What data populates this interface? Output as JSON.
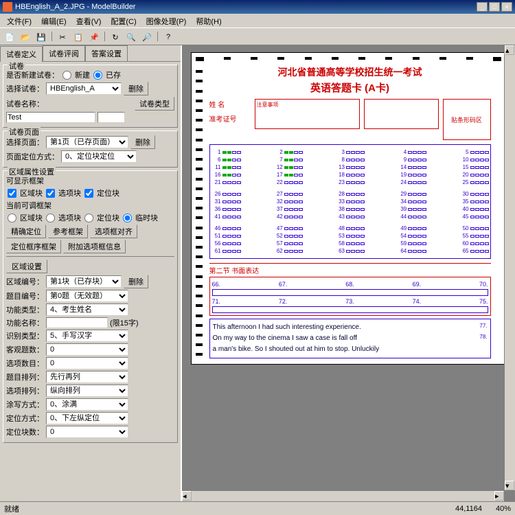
{
  "window": {
    "title": "HBEnglish_A_2.JPG - ModelBuilder"
  },
  "menu": [
    "文件(F)",
    "编辑(E)",
    "查看(V)",
    "配置(C)",
    "图像处理(P)",
    "帮助(H)"
  ],
  "tabs": [
    "试卷定义",
    "试卷评阅",
    "答案设置"
  ],
  "panel": {
    "group1_title": "试卷",
    "new_or_exist": "是否新建试卷：",
    "radio_new": "新建",
    "radio_exist": "已存",
    "select_label": "选择试卷：",
    "select_value": "HBEnglish_A",
    "delete": "删除",
    "name_label": "试卷名称：",
    "name_value": "",
    "test_value": "Test",
    "type_btn": "试卷类型",
    "group2_title": "试卷页面",
    "page_label": "选择页面：",
    "page_value": "第1页（已存页面）",
    "loc_label": "页面定位方式：",
    "loc_value": "0、定位块定位",
    "group3_title": "区域属性设置",
    "show_frame": "可显示框架",
    "area_block": "区域块",
    "opt_block": "选项块",
    "loc_block": "定位块",
    "adj_frame": "当前可调框架",
    "area_block2": "区域块",
    "opt_block2": "选项块",
    "loc_block2": "定位块",
    "temp_block": "临时块",
    "btn_precise": "精确定位",
    "btn_ref": "参考框架",
    "btn_align": "选项框对齐",
    "btn_locframe": "定位框序框架",
    "btn_add": "附加选项框信息",
    "area_num": "区域编号：",
    "area_num_val": "第1块（已存块）",
    "area_set": "区域设置",
    "q_num": "题目编号：",
    "q_num_val": "第0题（无效题）",
    "func_type": "功能类型：",
    "func_type_val": "4、考生姓名",
    "func_name": "功能名称：",
    "func_name_hint": "(限15字)",
    "recog_type": "识别类型：",
    "recog_type_val": "5、手写汉字",
    "obj_count": "客观题数：",
    "obj_count_val": "0",
    "opt_count": "选项数目：",
    "opt_count_val": "0",
    "q_arrange": "题目排列：",
    "q_arrange_val": "先行再列",
    "opt_arrange": "选项排列：",
    "opt_arrange_val": "纵向排列",
    "smear": "涂写方式：",
    "smear_val": "0、涂满",
    "pos_mode": "定位方式：",
    "pos_mode_val": "0、下左纵定位",
    "pos_block": "定位块数：",
    "pos_block_val": "0"
  },
  "sheet": {
    "title1": "河北省普通高等学校招生统一考试",
    "title2": "英语答题卡  (A卡)",
    "name_lbl": "姓    名",
    "id_lbl": "准考证号",
    "zone_lbl": "注意事项",
    "photo_lbl": "贴条形码区",
    "essay_hdr": "第二节 书面表达",
    "essay_nums_row1": [
      "66.",
      "67.",
      "68.",
      "69.",
      "70."
    ],
    "essay_nums_row2": [
      "71.",
      "72.",
      "73.",
      "74.",
      "75."
    ],
    "essay_lines": [
      "This afternoon I had such interesting experience.",
      "On my way to the cinema I saw a case is fall off",
      "a man's bike. So I shouted out at him to stop. Unluckily"
    ],
    "essay_rnums": [
      "77.",
      "78.",
      ""
    ]
  },
  "status": {
    "left": "就绪",
    "coords": "44,1164",
    "zoom": "40%"
  }
}
